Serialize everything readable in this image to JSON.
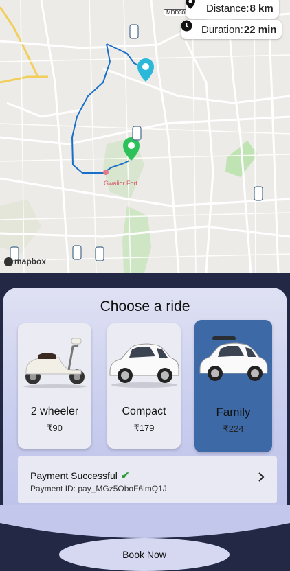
{
  "map": {
    "distance_label": "Distance:",
    "distance_value": "8 km",
    "duration_label": "Duration:",
    "duration_value": "22 min",
    "road_label": "MDD30B",
    "place_label": "Gwalior Fort",
    "attribution": "mapbox",
    "route_color": "#1a6fc9",
    "pickup_pin_color": "#2ec15a",
    "drop_pin_color": "#2bb8d9"
  },
  "panel": {
    "title": "Choose a ride",
    "rides": [
      {
        "name": "2 wheeler",
        "price": "₹90",
        "icon": "scooter-icon",
        "selected": false
      },
      {
        "name": "Compact",
        "price": "₹179",
        "icon": "car-icon",
        "selected": false
      },
      {
        "name": "Family",
        "price": "₹224",
        "icon": "suv-icon",
        "selected": true
      }
    ],
    "payment": {
      "status": "Payment Successful",
      "id_text": "Payment ID: pay_MGz5OboF6lmQ1J"
    },
    "book_button": "Book Now",
    "selected_color": "#3d69a6"
  }
}
